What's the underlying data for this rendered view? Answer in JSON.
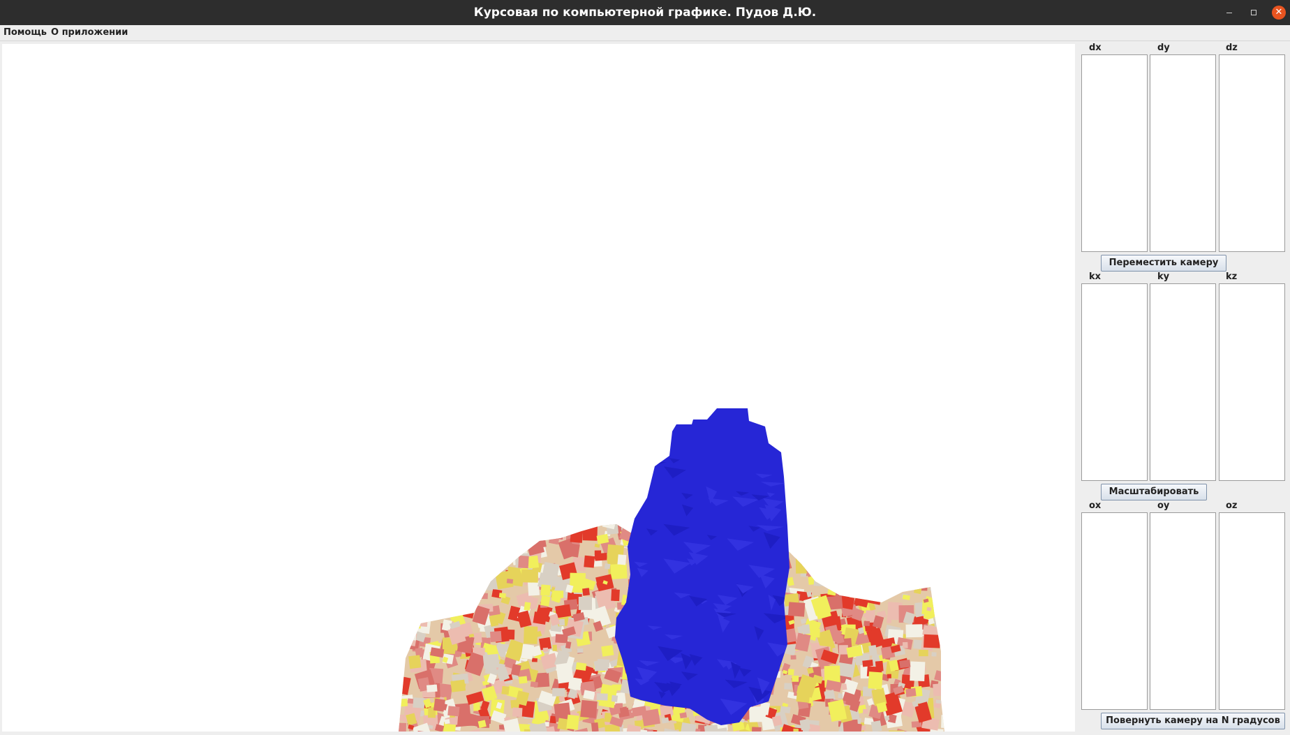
{
  "window": {
    "title": "Курсовая по компьютерной графике. Пудов Д.Ю."
  },
  "menu": {
    "items": [
      "Помощь",
      "О приложении"
    ]
  },
  "panel": {
    "groups": [
      {
        "labels": [
          "dx",
          "dy",
          "dz"
        ],
        "button": "Переместить камеру"
      },
      {
        "labels": [
          "kx",
          "ky",
          "kz"
        ],
        "button": "Масштабировать"
      },
      {
        "labels": [
          "ox",
          "oy",
          "oz"
        ],
        "button": "Повернуть камеру на N градусов"
      }
    ]
  },
  "colors": {
    "object_blue": "#2626d6",
    "terrain": [
      "#e23a2a",
      "#d9706a",
      "#e6d35a",
      "#f1ef5c",
      "#d8d0c4",
      "#ecbcb0",
      "#f3f1e6",
      "#e08a84"
    ]
  }
}
